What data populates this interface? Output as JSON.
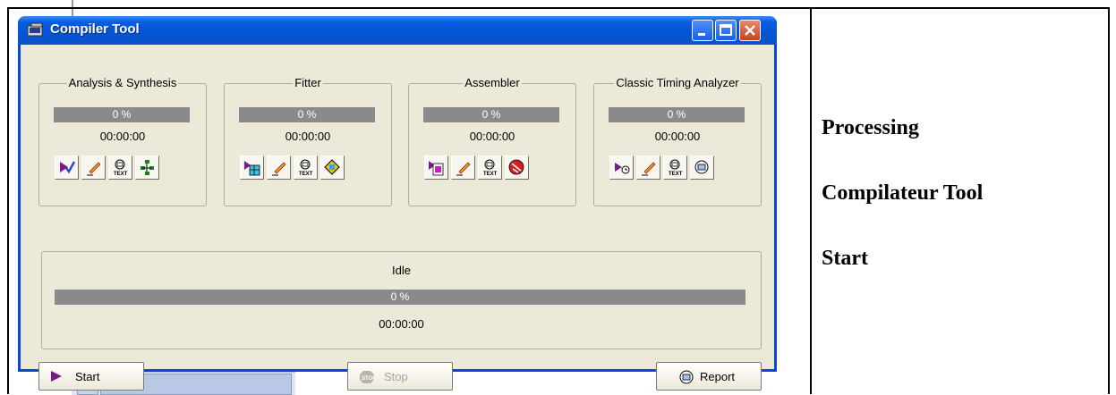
{
  "window": {
    "title": "Compiler Tool",
    "title_icon": "compiler-app-icon",
    "controls": [
      "minimize",
      "maximize",
      "close"
    ]
  },
  "stages": [
    {
      "label": "Analysis & Synthesis",
      "progress": "0 %",
      "time": "00:00:00",
      "icons": [
        "start-analysis-icon",
        "edit-settings-icon",
        "text-report-icon",
        "netlist-viewer-icon"
      ]
    },
    {
      "label": "Fitter",
      "progress": "0 %",
      "time": "00:00:00",
      "icons": [
        "start-fitter-icon",
        "edit-settings-icon",
        "text-report-icon",
        "floorplan-icon"
      ]
    },
    {
      "label": "Assembler",
      "progress": "0 %",
      "time": "00:00:00",
      "icons": [
        "start-assembler-icon",
        "edit-settings-icon",
        "text-report-icon",
        "programmer-icon"
      ]
    },
    {
      "label": "Classic Timing Analyzer",
      "progress": "0 %",
      "time": "00:00:00",
      "icons": [
        "start-timing-icon",
        "edit-settings-icon",
        "text-report-icon",
        "report-icon"
      ]
    }
  ],
  "overall": {
    "status": "Idle",
    "progress": "0 %",
    "time": "00:00:00"
  },
  "buttons": {
    "start": "Start",
    "stop": "Stop",
    "report": "Report"
  },
  "document": {
    "line1": "Processing",
    "line2": "Compilateur Tool",
    "line3": "Start"
  },
  "colors": {
    "titlebar": "#0a5de0",
    "window_bg": "#ece9d8",
    "progress_bar": "#8a8a8a",
    "start_arrow": "#7a1a8a"
  }
}
